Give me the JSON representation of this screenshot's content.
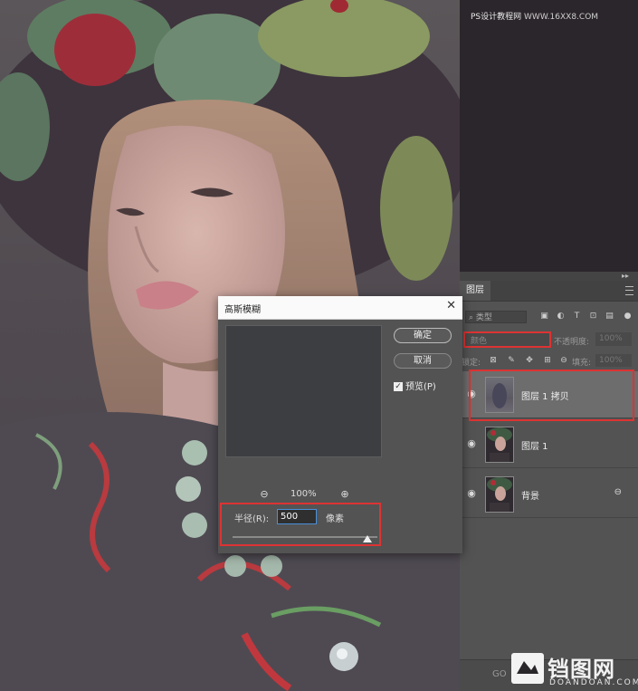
{
  "watermark": {
    "site_name": "PS设计教程网",
    "url": "WWW.16XX8.COM"
  },
  "dialog": {
    "title": "高斯模糊",
    "ok_label": "确定",
    "cancel_label": "取消",
    "preview_label": "预览(P)",
    "preview_checked": true,
    "zoom_value": "100%",
    "radius_label": "半径(R):",
    "radius_value": "500",
    "radius_unit": "像素",
    "slider_value_fraction": 0.93
  },
  "layers_panel": {
    "tab_label": "图层",
    "filter_kind": "类型",
    "blend_mode": "颜色",
    "opacity_label": "不透明度:",
    "opacity_value": "100%",
    "lock_label": "锁定:",
    "fill_label": "填充:",
    "fill_value": "100%",
    "layers": [
      {
        "name": "图层 1 拷贝",
        "selected": true,
        "visible": true,
        "locked": false
      },
      {
        "name": "图层 1",
        "selected": false,
        "visible": true,
        "locked": false
      },
      {
        "name": "背景",
        "selected": false,
        "visible": true,
        "locked": true
      }
    ],
    "footer_link": "GO"
  },
  "logo": {
    "text_cn": "铛图网",
    "text_en": "DOANDOAN.COM"
  },
  "colors": {
    "highlight_red": "#dd3333",
    "panel_gray": "#535353",
    "dialog_title_bg": "#fafafa"
  }
}
